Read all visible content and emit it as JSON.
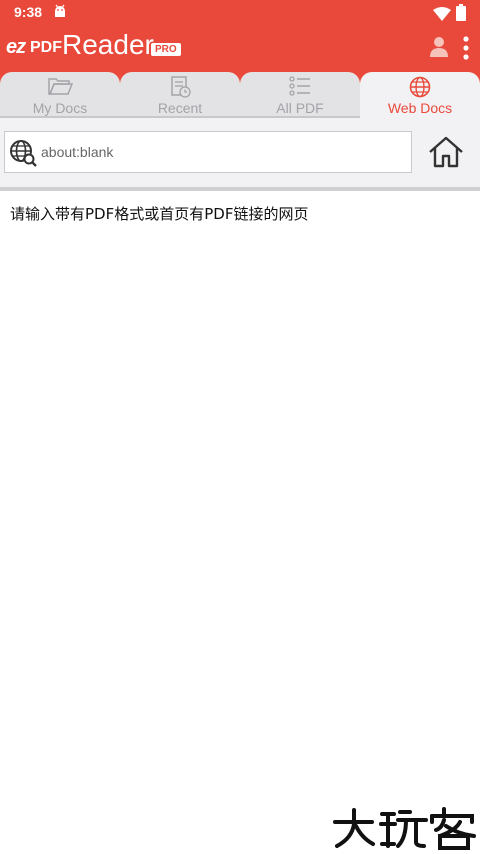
{
  "status_bar": {
    "time": "9:38"
  },
  "app_bar": {
    "logo_ez": "ez",
    "logo_pdf": "PDF",
    "logo_reader": "Reader",
    "logo_pro": "PRO",
    "brand_color": "#e9493b"
  },
  "tabs": [
    {
      "label": "My Docs",
      "icon": "folder-open-icon",
      "active": false
    },
    {
      "label": "Recent",
      "icon": "recent-doc-icon",
      "active": false
    },
    {
      "label": "All PDF",
      "icon": "list-icon",
      "active": false
    },
    {
      "label": "Web Docs",
      "icon": "globe-icon",
      "active": true
    }
  ],
  "browser": {
    "url_value": "about:blank"
  },
  "content": {
    "message": "请输入带有PDF格式或首页有PDF链接的网页"
  },
  "watermark": {
    "text": "大玩客"
  }
}
